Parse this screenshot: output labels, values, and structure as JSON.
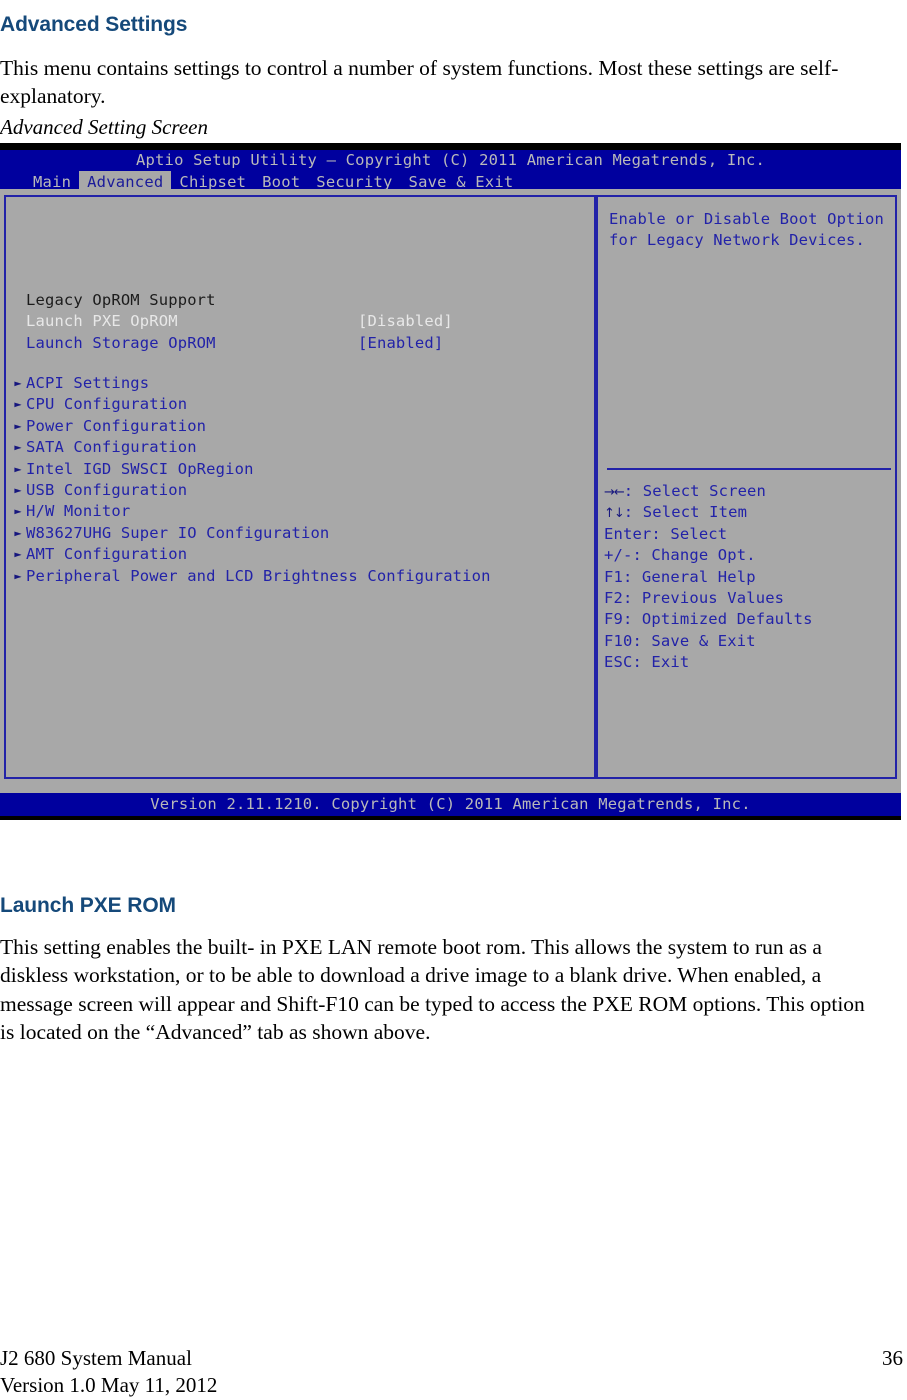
{
  "document": {
    "heading": "Advanced Settings",
    "intro_paragraph": "This menu contains settings to control a number of system functions. Most these settings are self-explanatory.",
    "figure_caption": "Advanced Setting Screen",
    "section2_heading": "Launch PXE ROM",
    "section2_paragraph": "This setting enables the built- in PXE LAN remote boot rom. This allows the system to run as a diskless workstation, or to be able to download a drive image to a blank drive. When enabled, a message screen will appear and Shift-F10 can be typed to access the PXE ROM options. This option is located on the “Advanced” tab as shown above."
  },
  "footer": {
    "manual_title": "J2 680 System Manual",
    "version_line": "Version 1.0 May 11, 2012",
    "page_number": "36"
  },
  "bios": {
    "header_title": "Aptio Setup Utility – Copyright (C) 2011 American Megatrends, Inc.",
    "footer_version": "Version 2.11.1210. Copyright (C) 2011 American Megatrends, Inc.",
    "tabs": [
      {
        "label": "Main",
        "active": false
      },
      {
        "label": "Advanced",
        "active": true
      },
      {
        "label": "Chipset",
        "active": false
      },
      {
        "label": "Boot",
        "active": false
      },
      {
        "label": "Security",
        "active": false
      },
      {
        "label": "Save & Exit",
        "active": false
      }
    ],
    "options": [
      {
        "label": "Legacy OpROM Support",
        "value": "",
        "style": "dark"
      },
      {
        "label": "Launch PXE OpROM",
        "value": "[Disabled]",
        "style": "white"
      },
      {
        "label": "Launch Storage OpROM",
        "value": "[Enabled]",
        "style": "blue"
      }
    ],
    "submenus": [
      "ACPI Settings",
      "CPU Configuration",
      "Power Configuration",
      "SATA Configuration",
      "Intel IGD SWSCI OpRegion",
      "USB Configuration",
      "H/W Monitor",
      "W83627UHG Super IO Configuration",
      "AMT Configuration",
      "Peripheral Power and LCD Brightness Configuration"
    ],
    "help": {
      "line1": "Enable or Disable Boot Option",
      "line2": "for Legacy Network Devices."
    },
    "keys": [
      {
        "glyph": "→←",
        "text": ": Select Screen"
      },
      {
        "glyph": "↑↓",
        "text": ": Select Item"
      },
      {
        "glyph": "",
        "text": "Enter: Select"
      },
      {
        "glyph": "",
        "text": "+/-: Change Opt."
      },
      {
        "glyph": "",
        "text": "F1: General Help"
      },
      {
        "glyph": "",
        "text": "F2: Previous Values"
      },
      {
        "glyph": "",
        "text": "F9: Optimized Defaults"
      },
      {
        "glyph": "",
        "text": "F10: Save & Exit"
      },
      {
        "glyph": "",
        "text": "ESC: Exit"
      }
    ],
    "colors": {
      "header_blue": "#00009e",
      "body_gray": "#a8a8a8",
      "text_blue": "#2222a8",
      "tab_active_bg": "#a8a8a8"
    }
  }
}
